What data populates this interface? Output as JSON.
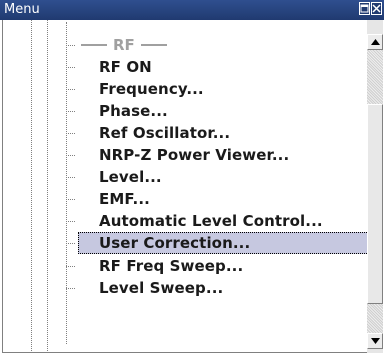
{
  "window": {
    "title": "Menu"
  },
  "menu": {
    "section_header": "RF",
    "items": [
      {
        "label": "RF ON"
      },
      {
        "label": "Frequency..."
      },
      {
        "label": "Phase..."
      },
      {
        "label": "Ref Oscillator..."
      },
      {
        "label": "NRP-Z Power Viewer..."
      },
      {
        "label": "Level..."
      },
      {
        "label": "EMF..."
      },
      {
        "label": "Automatic Level Control..."
      },
      {
        "label": "User Correction...",
        "selected": true
      },
      {
        "label": "RF Freq Sweep..."
      },
      {
        "label": "Level Sweep..."
      }
    ]
  },
  "icons": {
    "restore": "restore-icon",
    "close": "close-icon",
    "scroll_up": "arrow-up-icon",
    "scroll_down": "arrow-down-icon"
  },
  "colors": {
    "titlebar": "#203a70",
    "selection": "#c6c8e0",
    "header_text": "#a0a0a0"
  }
}
